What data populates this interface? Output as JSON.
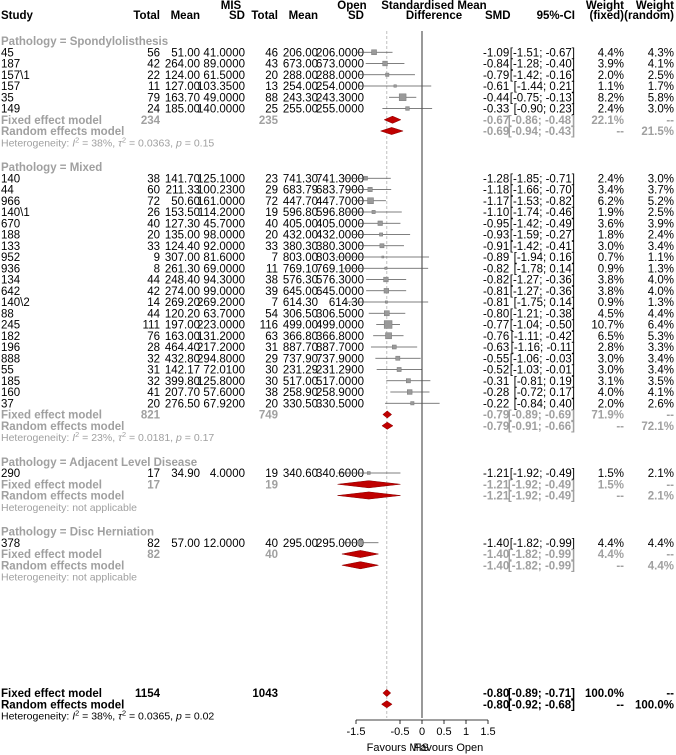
{
  "headers": {
    "study": "Study",
    "mis_group": "MIS",
    "open_group": "Open",
    "total": "Total",
    "mean": "Mean",
    "sd": "SD",
    "effect": "Standardised Mean",
    "effect2": "Difference",
    "smd": "SMD",
    "ci": "95%-CI",
    "weight": "Weight",
    "fixed": "(fixed)",
    "random": "(random)"
  },
  "axis": {
    "ticks": [
      "-1.5",
      "-0.5",
      "0",
      "0.5",
      "1",
      "1.5"
    ],
    "left_label": "Favours MIS",
    "right_label": "Favours Open"
  },
  "chart_data": {
    "type": "forest",
    "xlim": [
      -1.5,
      1.5
    ],
    "reference_line": 0,
    "groups": [
      {
        "title": "Pathology = Spondylolisthesis",
        "studies": [
          {
            "study": "45",
            "mis_total": "56",
            "mis_mean": "51.00",
            "mis_sd": "41.0000",
            "open_total": "46",
            "open_mean": "206.00",
            "open_sd": "206.0000",
            "smd": -1.09,
            "lo": -1.51,
            "hi": -0.67,
            "smd_text": "-1.09",
            "ci_text": "[-1.51; -0.67]",
            "w_fixed": "4.4%",
            "w_random": "4.3%",
            "w": 4.4
          },
          {
            "study": "187",
            "mis_total": "42",
            "mis_mean": "264.00",
            "mis_sd": "89.0000",
            "open_total": "43",
            "open_mean": "673.00",
            "open_sd": "673.0000",
            "smd": -0.84,
            "lo": -1.28,
            "hi": -0.4,
            "smd_text": "-0.84",
            "ci_text": "[-1.28; -0.40]",
            "w_fixed": "3.9%",
            "w_random": "4.1%",
            "w": 3.9
          },
          {
            "study": "157\\1",
            "mis_total": "22",
            "mis_mean": "124.00",
            "mis_sd": "61.5000",
            "open_total": "20",
            "open_mean": "288.00",
            "open_sd": "288.0000",
            "smd": -0.79,
            "lo": -1.42,
            "hi": -0.16,
            "smd_text": "-0.79",
            "ci_text": "[-1.42; -0.16]",
            "w_fixed": "2.0%",
            "w_random": "2.5%",
            "w": 2.0
          },
          {
            "study": "157",
            "mis_total": "11",
            "mis_mean": "127.00",
            "mis_sd": "103.3500",
            "open_total": "13",
            "open_mean": "254.00",
            "open_sd": "254.0000",
            "smd": -0.61,
            "lo": -1.44,
            "hi": 0.21,
            "smd_text": "-0.61",
            "ci_text": "[-1.44; 0.21]",
            "w_fixed": "1.1%",
            "w_random": "1.7%",
            "w": 1.1
          },
          {
            "study": "35",
            "mis_total": "79",
            "mis_mean": "163.70",
            "mis_sd": "49.0000",
            "open_total": "88",
            "open_mean": "243.30",
            "open_sd": "243.3000",
            "smd": -0.44,
            "lo": -0.75,
            "hi": -0.13,
            "smd_text": "-0.44",
            "ci_text": "[-0.75; -0.13]",
            "w_fixed": "8.2%",
            "w_random": "5.8%",
            "w": 8.2
          },
          {
            "study": "149",
            "mis_total": "24",
            "mis_mean": "185.00",
            "mis_sd": "140.0000",
            "open_total": "25",
            "open_mean": "255.00",
            "open_sd": "255.0000",
            "smd": -0.33,
            "lo": -0.9,
            "hi": 0.23,
            "smd_text": "-0.33",
            "ci_text": "[-0.90; 0.23]",
            "w_fixed": "2.4%",
            "w_random": "3.0%",
            "w": 2.4
          }
        ],
        "fixed": {
          "label": "Fixed effect model",
          "mis_total": "234",
          "open_total": "235",
          "smd": -0.67,
          "lo": -0.86,
          "hi": -0.48,
          "smd_text": "-0.67",
          "ci_text": "[-0.86; -0.48]",
          "w_fixed": "22.1%",
          "w_random": "--"
        },
        "random": {
          "label": "Random effects model",
          "smd": -0.69,
          "lo": -0.94,
          "hi": -0.43,
          "smd_text": "-0.69",
          "ci_text": "[-0.94; -0.43]",
          "w_fixed": "--",
          "w_random": "21.5%"
        },
        "heterogeneity": {
          "type": "full",
          "prefix": "Heterogeneity: ",
          "i2": "38%",
          "tau2": "0.0363",
          "p": "0.15"
        }
      },
      {
        "title": "Pathology = Mixed",
        "studies": [
          {
            "study": "140",
            "mis_total": "38",
            "mis_mean": "141.70",
            "mis_sd": "125.1000",
            "open_total": "23",
            "open_mean": "741.30",
            "open_sd": "741.3000",
            "smd": -1.28,
            "lo": -1.85,
            "hi": -0.71,
            "smd_text": "-1.28",
            "ci_text": "[-1.85; -0.71]",
            "w_fixed": "2.4%",
            "w_random": "3.0%",
            "w": 2.4
          },
          {
            "study": "44",
            "mis_total": "60",
            "mis_mean": "211.33",
            "mis_sd": "100.2300",
            "open_total": "29",
            "open_mean": "683.79",
            "open_sd": "683.7900",
            "smd": -1.18,
            "lo": -1.66,
            "hi": -0.7,
            "smd_text": "-1.18",
            "ci_text": "[-1.66; -0.70]",
            "w_fixed": "3.4%",
            "w_random": "3.7%",
            "w": 3.4
          },
          {
            "study": "966",
            "mis_total": "72",
            "mis_mean": "50.60",
            "mis_sd": "161.0000",
            "open_total": "72",
            "open_mean": "447.70",
            "open_sd": "447.7000",
            "smd": -1.17,
            "lo": -1.53,
            "hi": -0.82,
            "smd_text": "-1.17",
            "ci_text": "[-1.53; -0.82]",
            "w_fixed": "6.2%",
            "w_random": "5.2%",
            "w": 6.2
          },
          {
            "study": "140\\1",
            "mis_total": "26",
            "mis_mean": "153.50",
            "mis_sd": "114.2000",
            "open_total": "19",
            "open_mean": "596.80",
            "open_sd": "596.8000",
            "smd": -1.1,
            "lo": -1.74,
            "hi": -0.46,
            "smd_text": "-1.10",
            "ci_text": "[-1.74; -0.46]",
            "w_fixed": "1.9%",
            "w_random": "2.5%",
            "w": 1.9
          },
          {
            "study": "670",
            "mis_total": "40",
            "mis_mean": "127.30",
            "mis_sd": "45.7000",
            "open_total": "40",
            "open_mean": "405.00",
            "open_sd": "405.0000",
            "smd": -0.95,
            "lo": -1.42,
            "hi": -0.49,
            "smd_text": "-0.95",
            "ci_text": "[-1.42; -0.49]",
            "w_fixed": "3.6%",
            "w_random": "3.9%",
            "w": 3.6
          },
          {
            "study": "188",
            "mis_total": "20",
            "mis_mean": "135.00",
            "mis_sd": "98.0000",
            "open_total": "20",
            "open_mean": "432.00",
            "open_sd": "432.0000",
            "smd": -0.93,
            "lo": -1.59,
            "hi": -0.27,
            "smd_text": "-0.93",
            "ci_text": "[-1.59; -0.27]",
            "w_fixed": "1.8%",
            "w_random": "2.4%",
            "w": 1.8
          },
          {
            "study": "133",
            "mis_total": "33",
            "mis_mean": "124.40",
            "mis_sd": "92.0000",
            "open_total": "33",
            "open_mean": "380.30",
            "open_sd": "380.3000",
            "smd": -0.91,
            "lo": -1.42,
            "hi": -0.41,
            "smd_text": "-0.91",
            "ci_text": "[-1.42; -0.41]",
            "w_fixed": "3.0%",
            "w_random": "3.4%",
            "w": 3.0
          },
          {
            "study": "952",
            "mis_total": "9",
            "mis_mean": "307.00",
            "mis_sd": "81.6000",
            "open_total": "7",
            "open_mean": "803.00",
            "open_sd": "803.0000",
            "smd": -0.89,
            "lo": -1.94,
            "hi": 0.16,
            "smd_text": "-0.89",
            "ci_text": "[-1.94; 0.16]",
            "w_fixed": "0.7%",
            "w_random": "1.1%",
            "w": 0.7
          },
          {
            "study": "936",
            "mis_total": "8",
            "mis_mean": "261.30",
            "mis_sd": "69.0000",
            "open_total": "11",
            "open_mean": "769.10",
            "open_sd": "769.1000",
            "smd": -0.82,
            "lo": -1.78,
            "hi": 0.14,
            "smd_text": "-0.82",
            "ci_text": "[-1.78; 0.14]",
            "w_fixed": "0.9%",
            "w_random": "1.3%",
            "w": 0.9
          },
          {
            "study": "134",
            "mis_total": "44",
            "mis_mean": "248.40",
            "mis_sd": "94.3000",
            "open_total": "38",
            "open_mean": "576.30",
            "open_sd": "576.3000",
            "smd": -0.82,
            "lo": -1.27,
            "hi": -0.36,
            "smd_text": "-0.82",
            "ci_text": "[-1.27; -0.36]",
            "w_fixed": "3.8%",
            "w_random": "4.0%",
            "w": 3.8
          },
          {
            "study": "642",
            "mis_total": "42",
            "mis_mean": "274.00",
            "mis_sd": "99.0000",
            "open_total": "39",
            "open_mean": "645.00",
            "open_sd": "645.0000",
            "smd": -0.81,
            "lo": -1.27,
            "hi": -0.36,
            "smd_text": "-0.81",
            "ci_text": "[-1.27; -0.36]",
            "w_fixed": "3.8%",
            "w_random": "4.0%",
            "w": 3.8
          },
          {
            "study": "140\\2",
            "mis_total": "14",
            "mis_mean": "269.20",
            "mis_sd": "269.2000",
            "open_total": "7",
            "open_mean": "614.30",
            "open_sd": "614.30",
            "smd": -0.81,
            "lo": -1.75,
            "hi": 0.14,
            "smd_text": "-0.81",
            "ci_text": "[-1.75; 0.14]",
            "w_fixed": "0.9%",
            "w_random": "1.3%",
            "w": 0.9
          },
          {
            "study": "88",
            "mis_total": "44",
            "mis_mean": "120.20",
            "mis_sd": "63.7000",
            "open_total": "54",
            "open_mean": "306.50",
            "open_sd": "306.5000",
            "smd": -0.8,
            "lo": -1.21,
            "hi": -0.38,
            "smd_text": "-0.80",
            "ci_text": "[-1.21; -0.38]",
            "w_fixed": "4.5%",
            "w_random": "4.4%",
            "w": 4.5
          },
          {
            "study": "245",
            "mis_total": "111",
            "mis_mean": "197.00",
            "mis_sd": "223.0000",
            "open_total": "116",
            "open_mean": "499.00",
            "open_sd": "499.0000",
            "smd": -0.77,
            "lo": -1.04,
            "hi": -0.5,
            "smd_text": "-0.77",
            "ci_text": "[-1.04; -0.50]",
            "w_fixed": "10.7%",
            "w_random": "6.4%",
            "w": 10.7
          },
          {
            "study": "182",
            "mis_total": "76",
            "mis_mean": "163.00",
            "mis_sd": "131.2000",
            "open_total": "63",
            "open_mean": "366.80",
            "open_sd": "366.8000",
            "smd": -0.76,
            "lo": -1.11,
            "hi": -0.42,
            "smd_text": "-0.76",
            "ci_text": "[-1.11; -0.42]",
            "w_fixed": "6.5%",
            "w_random": "5.3%",
            "w": 6.5
          },
          {
            "study": "196",
            "mis_total": "28",
            "mis_mean": "464.40",
            "mis_sd": "217.2000",
            "open_total": "31",
            "open_mean": "887.70",
            "open_sd": "887.7000",
            "smd": -0.63,
            "lo": -1.16,
            "hi": -0.11,
            "smd_text": "-0.63",
            "ci_text": "[-1.16; -0.11]",
            "w_fixed": "2.8%",
            "w_random": "3.3%",
            "w": 2.8
          },
          {
            "study": "888",
            "mis_total": "32",
            "mis_mean": "432.80",
            "mis_sd": "294.8000",
            "open_total": "29",
            "open_mean": "737.90",
            "open_sd": "737.9000",
            "smd": -0.55,
            "lo": -1.06,
            "hi": -0.03,
            "smd_text": "-0.55",
            "ci_text": "[-1.06; -0.03]",
            "w_fixed": "3.0%",
            "w_random": "3.4%",
            "w": 3.0
          },
          {
            "study": "55",
            "mis_total": "31",
            "mis_mean": "142.17",
            "mis_sd": "72.0100",
            "open_total": "30",
            "open_mean": "231.29",
            "open_sd": "231.2900",
            "smd": -0.52,
            "lo": -1.03,
            "hi": -0.01,
            "smd_text": "-0.52",
            "ci_text": "[-1.03; -0.01]",
            "w_fixed": "3.0%",
            "w_random": "3.4%",
            "w": 3.0
          },
          {
            "study": "185",
            "mis_total": "32",
            "mis_mean": "399.80",
            "mis_sd": "125.8000",
            "open_total": "30",
            "open_mean": "517.00",
            "open_sd": "517.0000",
            "smd": -0.31,
            "lo": -0.81,
            "hi": 0.19,
            "smd_text": "-0.31",
            "ci_text": "[-0.81; 0.19]",
            "w_fixed": "3.1%",
            "w_random": "3.5%",
            "w": 3.1
          },
          {
            "study": "160",
            "mis_total": "41",
            "mis_mean": "207.70",
            "mis_sd": "57.6000",
            "open_total": "38",
            "open_mean": "258.90",
            "open_sd": "258.9000",
            "smd": -0.28,
            "lo": -0.72,
            "hi": 0.17,
            "smd_text": "-0.28",
            "ci_text": "[-0.72; 0.17]",
            "w_fixed": "4.0%",
            "w_random": "4.1%",
            "w": 4.0
          },
          {
            "study": "37",
            "mis_total": "20",
            "mis_mean": "276.50",
            "mis_sd": "67.9200",
            "open_total": "20",
            "open_mean": "330.50",
            "open_sd": "330.5000",
            "smd": -0.22,
            "lo": -0.84,
            "hi": 0.4,
            "smd_text": "-0.22",
            "ci_text": "[-0.84; 0.40]",
            "w_fixed": "2.0%",
            "w_random": "2.6%",
            "w": 2.0
          }
        ],
        "fixed": {
          "label": "Fixed effect model",
          "mis_total": "821",
          "open_total": "749",
          "smd": -0.79,
          "lo": -0.89,
          "hi": -0.69,
          "smd_text": "-0.79",
          "ci_text": "[-0.89; -0.69]",
          "w_fixed": "71.9%",
          "w_random": "--"
        },
        "random": {
          "label": "Random effects model",
          "smd": -0.79,
          "lo": -0.91,
          "hi": -0.66,
          "smd_text": "-0.79",
          "ci_text": "[-0.91; -0.66]",
          "w_fixed": "--",
          "w_random": "72.1%"
        },
        "heterogeneity": {
          "type": "full",
          "prefix": "Heterogeneity: ",
          "i2": "23%",
          "tau2": "0.0181",
          "p": "0.17"
        }
      },
      {
        "title": "Pathology = Adjacent Level Disease",
        "studies": [
          {
            "study": "290",
            "mis_total": "17",
            "mis_mean": "34.90",
            "mis_sd": "4.0000",
            "open_total": "19",
            "open_mean": "340.60",
            "open_sd": "340.6000",
            "smd": -1.21,
            "lo": -1.92,
            "hi": -0.49,
            "smd_text": "-1.21",
            "ci_text": "[-1.92; -0.49]",
            "w_fixed": "1.5%",
            "w_random": "2.1%",
            "w": 1.5
          }
        ],
        "fixed": {
          "label": "Fixed effect model",
          "mis_total": "17",
          "open_total": "19",
          "smd": -1.21,
          "lo": -1.92,
          "hi": -0.49,
          "smd_text": "-1.21",
          "ci_text": "[-1.92; -0.49]",
          "w_fixed": "1.5%",
          "w_random": "--"
        },
        "random": {
          "label": "Random effects model",
          "smd": -1.21,
          "lo": -1.92,
          "hi": -0.49,
          "smd_text": "-1.21",
          "ci_text": "[-1.92; -0.49]",
          "w_fixed": "--",
          "w_random": "2.1%"
        },
        "heterogeneity": {
          "type": "text",
          "text": "Heterogeneity: not applicable"
        }
      },
      {
        "title": "Pathology = Disc Herniation",
        "studies": [
          {
            "study": "378",
            "mis_total": "82",
            "mis_mean": "57.00",
            "mis_sd": "12.0000",
            "open_total": "40",
            "open_mean": "295.00",
            "open_sd": "295.0000",
            "smd": -1.4,
            "lo": -1.82,
            "hi": -0.99,
            "smd_text": "-1.40",
            "ci_text": "[-1.82; -0.99]",
            "w_fixed": "4.4%",
            "w_random": "4.4%",
            "w": 4.4
          }
        ],
        "fixed": {
          "label": "Fixed effect model",
          "mis_total": "82",
          "open_total": "40",
          "smd": -1.4,
          "lo": -1.82,
          "hi": -0.99,
          "smd_text": "-1.40",
          "ci_text": "[-1.82; -0.99]",
          "w_fixed": "4.4%",
          "w_random": "--"
        },
        "random": {
          "label": "Random effects model",
          "smd": -1.4,
          "lo": -1.82,
          "hi": -0.99,
          "smd_text": "-1.40",
          "ci_text": "[-1.82; -0.99]",
          "w_fixed": "--",
          "w_random": "4.4%"
        },
        "heterogeneity": {
          "type": "text",
          "text": "Heterogeneity: not applicable"
        }
      }
    ],
    "overall": {
      "fixed": {
        "label": "Fixed effect model",
        "mis_total": "1154",
        "open_total": "1043",
        "smd": -0.8,
        "lo": -0.89,
        "hi": -0.71,
        "smd_text": "-0.80",
        "ci_text": "[-0.89; -0.71]",
        "w_fixed": "100.0%",
        "w_random": "--"
      },
      "random": {
        "label": "Random effects model",
        "smd": -0.8,
        "lo": -0.92,
        "hi": -0.68,
        "smd_text": "-0.80",
        "ci_text": "[-0.92; -0.68]",
        "w_fixed": "--",
        "w_random": "100.0%"
      },
      "heterogeneity": {
        "type": "full",
        "prefix": "Heterogeneity: ",
        "i2": "38%",
        "tau2": "0.0365",
        "p": "0.02"
      }
    }
  }
}
